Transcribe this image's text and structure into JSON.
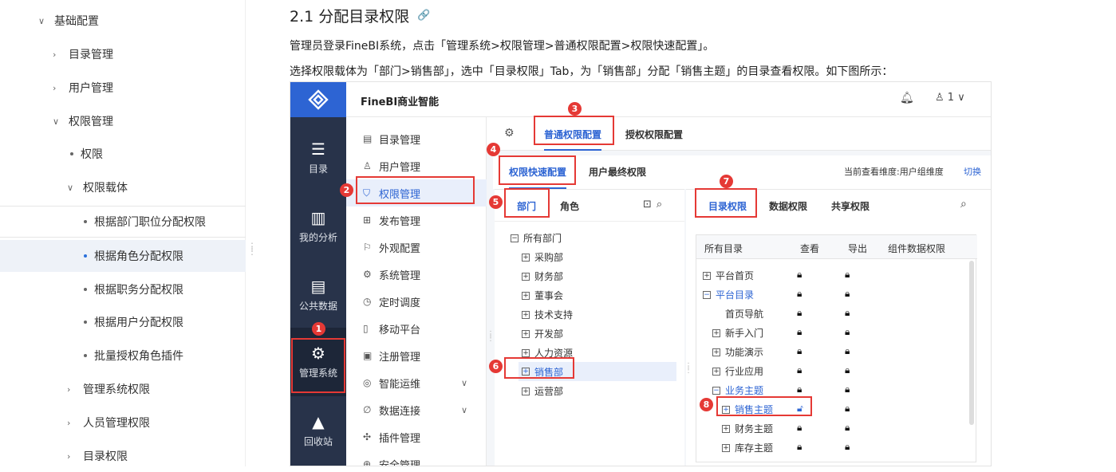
{
  "doc_nav": [
    {
      "label": "基础配置",
      "kind": "expanded"
    },
    {
      "label": "目录管理",
      "kind": "collapsed"
    },
    {
      "label": "用户管理",
      "kind": "collapsed"
    },
    {
      "label": "权限管理",
      "kind": "expanded"
    },
    {
      "label": "权限",
      "kind": "bullet"
    },
    {
      "label": "权限载体",
      "kind": "expanded"
    },
    {
      "label": "根据部门职位分配权限",
      "kind": "bullet-active"
    },
    {
      "label": "根据角色分配权限",
      "kind": "bullet-hover"
    },
    {
      "label": "根据职务分配权限",
      "kind": "bullet"
    },
    {
      "label": "根据用户分配权限",
      "kind": "bullet"
    },
    {
      "label": "批量授权角色插件",
      "kind": "bullet"
    },
    {
      "label": "管理系统权限",
      "kind": "collapsed"
    },
    {
      "label": "人员管理权限",
      "kind": "collapsed"
    },
    {
      "label": "目录权限",
      "kind": "collapsed"
    }
  ],
  "article": {
    "heading": "2.1 分配目录权限",
    "para1": "管理员登录FineBI系统，点击「管理系统>权限管理>普通权限配置>权限快速配置」。",
    "para2": "选择权限载体为「部门>销售部」，选中「目录权限」Tab，为「销售部」分配「销售主题」的目录查看权限。如下图所示："
  },
  "app": {
    "brand": "FineBI商业智能",
    "user": "1",
    "leftbar": [
      "目录",
      "我的分析",
      "公共数据",
      "管理系统",
      "回收站"
    ],
    "menu": [
      "目录管理",
      "用户管理",
      "权限管理",
      "发布管理",
      "外观配置",
      "系统管理",
      "定时调度",
      "移动平台",
      "注册管理",
      "智能运维",
      "数据连接",
      "插件管理",
      "安全管理"
    ],
    "tabs1": [
      "普通权限配置",
      "授权权限配置"
    ],
    "tabs2": [
      "权限快速配置",
      "用户最终权限"
    ],
    "dimension_text": "当前查看维度:用户组维度",
    "switch_label": "切换",
    "carrier_tabs": [
      "部门",
      "角色"
    ],
    "dept_tree": [
      "所有部门",
      "采购部",
      "财务部",
      "董事会",
      "技术支持",
      "开发部",
      "人力资源",
      "销售部",
      "运营部"
    ],
    "perm_tabs": [
      "目录权限",
      "数据权限",
      "共享权限"
    ],
    "grid_headers": [
      "所有目录",
      "查看",
      "导出",
      "组件数据权限"
    ],
    "grid_rows": [
      "平台首页",
      "平台目录",
      "首页导航",
      "新手入门",
      "功能演示",
      "行业应用",
      "业务主题",
      "销售主题",
      "财务主题",
      "库存主题"
    ],
    "badges": [
      "1",
      "2",
      "3",
      "4",
      "5",
      "6",
      "7",
      "8"
    ],
    "colors": {
      "accent": "#2d64d3",
      "sidebar": "#28334a",
      "annotation": "#e53935"
    }
  }
}
